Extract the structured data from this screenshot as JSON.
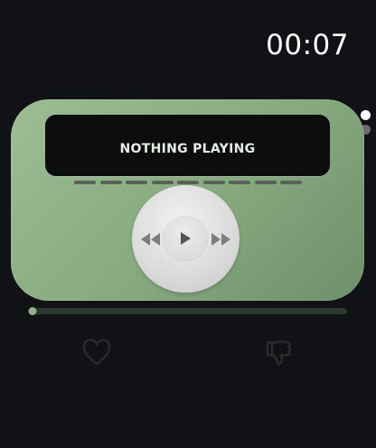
{
  "status_bar": {
    "time": "00:07"
  },
  "player": {
    "now_playing": "NOTHING PLAYING",
    "progress": 0.01,
    "level_bar_count": 9
  },
  "colors": {
    "background": "#111216",
    "card_accent": "#8fb386",
    "level_bar": "#5d5f5b",
    "page_dot_active": "#ffffff",
    "page_dot_inactive": "#6b6b6b",
    "icon_dim": "#2a2c2b"
  },
  "page_indicator": {
    "total": 2,
    "active": 0
  },
  "icons": {
    "play": "play-icon",
    "rewind": "rewind-icon",
    "fast_forward": "fast-forward-icon",
    "like": "heart-icon",
    "dislike": "thumbs-down-icon"
  }
}
